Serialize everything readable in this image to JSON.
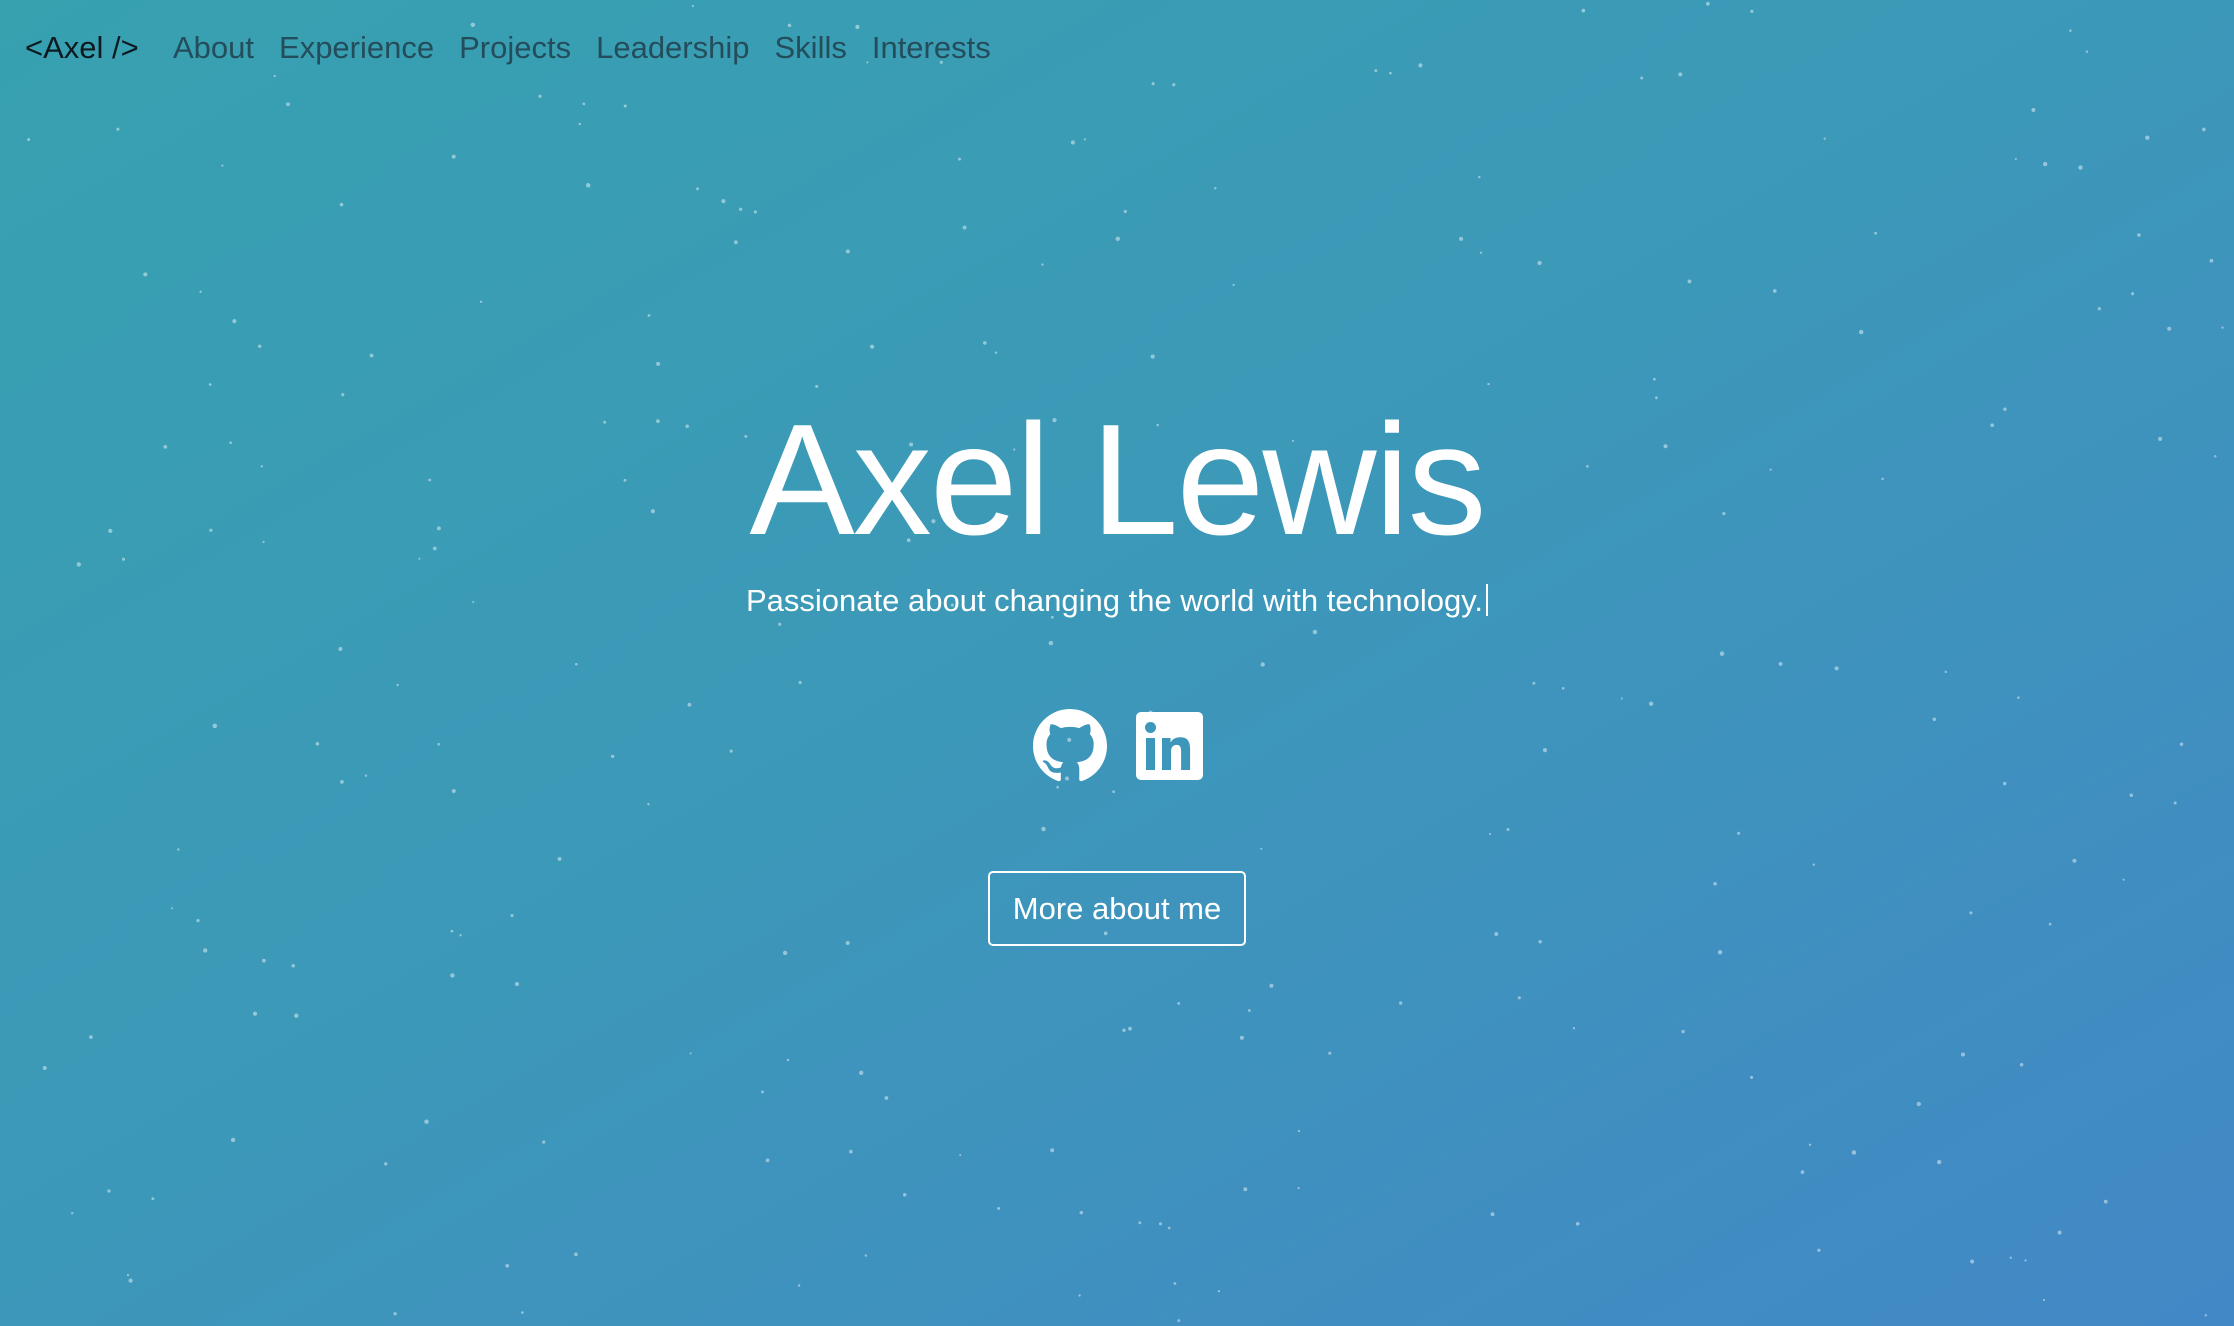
{
  "navbar": {
    "brand": "<Axel />",
    "links": [
      "About",
      "Experience",
      "Projects",
      "Leadership",
      "Skills",
      "Interests"
    ]
  },
  "hero": {
    "name": "Axel Lewis",
    "tagline": "Passionate about changing the world with technology.",
    "cta_label": "More about me",
    "social_icons": [
      "github-icon",
      "linkedin-icon"
    ]
  },
  "colors": {
    "gradient_start": "#37a1b0",
    "gradient_end": "#4288c6",
    "brand_text": "#0c1a20",
    "nav_text": "#244d5b",
    "hero_text": "#ffffff"
  }
}
